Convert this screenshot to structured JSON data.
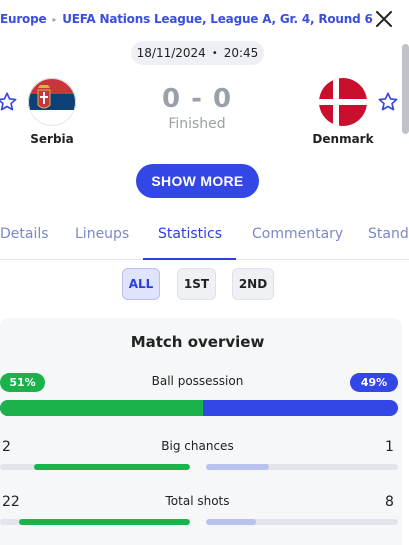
{
  "breadcrumb": {
    "items": [
      "Europe",
      "UEFA Nations League, League A, Gr. 4, Round 6"
    ],
    "separator": "▸"
  },
  "match": {
    "date": "18/11/2024",
    "time": "20:45",
    "dot": "•",
    "home": {
      "name": "Serbia",
      "flag": "serbia-flag"
    },
    "away": {
      "name": "Denmark",
      "flag": "denmark-flag"
    },
    "score": "0 - 0",
    "status": "Finished"
  },
  "actions": {
    "show_more": "SHOW MORE"
  },
  "tabs": [
    {
      "label": "Details",
      "active": false
    },
    {
      "label": "Lineups",
      "active": false
    },
    {
      "label": "Statistics",
      "active": true
    },
    {
      "label": "Commentary",
      "active": false
    },
    {
      "label": "Standi",
      "active": false
    }
  ],
  "periods": [
    {
      "label": "ALL",
      "active": true
    },
    {
      "label": "1ST",
      "active": false
    },
    {
      "label": "2ND",
      "active": false
    }
  ],
  "overview": {
    "title": "Match overview",
    "possession": {
      "label": "Ball possession",
      "home": "51%",
      "away": "49%",
      "home_share": 0.51
    },
    "stats": [
      {
        "label": "Big chances",
        "home": "2",
        "away": "1",
        "home_fill": 0.82,
        "away_fill": 0.33
      },
      {
        "label": "Total shots",
        "home": "22",
        "away": "8",
        "home_fill": 0.9,
        "away_fill": 0.26
      }
    ]
  },
  "colors": {
    "accent": "#3346e6",
    "home": "#1bb14b",
    "away": "#3346e6"
  }
}
